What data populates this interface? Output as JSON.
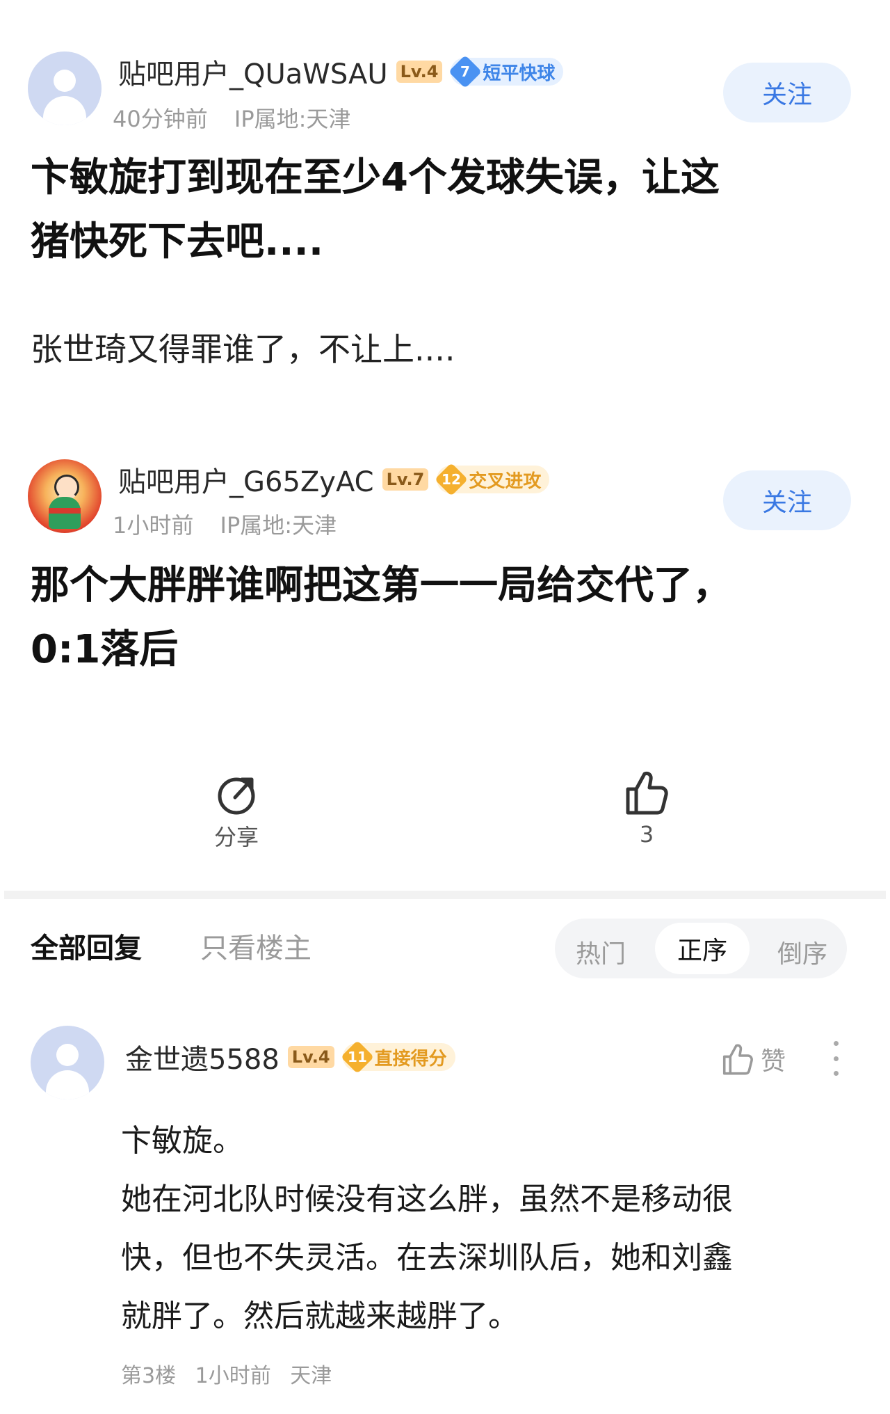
{
  "posts": [
    {
      "username": "贴吧用户_QUaWSAU",
      "level": "Lv.4",
      "badge_num": "7",
      "badge_label": "短平快球",
      "time": "40分钟前",
      "ip": "IP属地:天津",
      "follow_label": "关注",
      "title_line1": "卞敏旋打到现在至少4个发球失误，让这",
      "title_line2": "猪快死下去吧....",
      "body": "张世琦又得罪谁了，不让上...."
    },
    {
      "username": "贴吧用户_G65ZyAC",
      "level": "Lv.7",
      "badge_num": "12",
      "badge_label": "交叉进攻",
      "time": "1小时前",
      "ip": "IP属地:天津",
      "follow_label": "关注",
      "title_line1": "那个大胖胖谁啊把这第一一局给交代了，",
      "title_line2": "0:1落后"
    }
  ],
  "actions": {
    "share_label": "分享",
    "like_count": "3"
  },
  "replies_header": {
    "all_label": "全部回复",
    "op_only_label": "只看楼主",
    "sort_hot": "热门",
    "sort_asc": "正序",
    "sort_desc": "倒序"
  },
  "reply": {
    "username": "金世遗5588",
    "level": "Lv.4",
    "badge_num": "11",
    "badge_label": "直接得分",
    "like_label": "赞",
    "line1": "卞敏旋。",
    "line2": "她在河北队时候没有这么胖，虽然不是移动很",
    "line3": "快，但也不失灵活。在去深圳队后，她和刘鑫",
    "line4": "就胖了。然后就越来越胖了。",
    "floor": "第3楼",
    "time": "1小时前",
    "location": "天津"
  },
  "icons": [
    "share-icon",
    "thumbs-up-icon",
    "more-icon"
  ],
  "colors": {
    "accent_blue": "#3978e3",
    "follow_bg": "#eaf2fd",
    "badge_gold": "#f5b02e",
    "badge_blue": "#4a92f2"
  }
}
